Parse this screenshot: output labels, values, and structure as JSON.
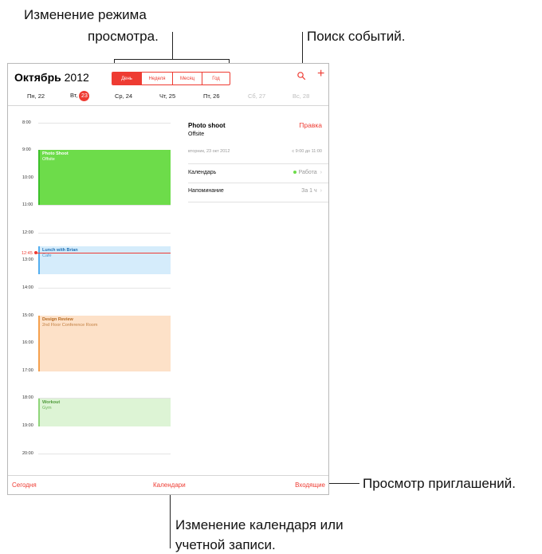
{
  "callouts": {
    "view_mode_line1": "Изменение режима",
    "view_mode_line2": "просмотра.",
    "search": "Поиск событий.",
    "invites": "Просмотр приглашений.",
    "calendar_line1": "Изменение календаря или",
    "calendar_line2": "учетной записи."
  },
  "header": {
    "month": "Октябрь",
    "year": "2012",
    "views": [
      "День",
      "Неделя",
      "Месяц",
      "Год"
    ],
    "active_view": "День",
    "search_icon": "search-icon",
    "add_icon": "plus-icon",
    "add_label": "+"
  },
  "week": {
    "days": [
      {
        "label": "Пн, 22"
      },
      {
        "label": "Вт,",
        "num": "23",
        "today": true
      },
      {
        "label": "Ср, 24"
      },
      {
        "label": "Чт, 25"
      },
      {
        "label": "Пт, 26"
      },
      {
        "label": "Сб, 27",
        "weekend": true
      },
      {
        "label": "Вс, 28",
        "weekend": true
      }
    ]
  },
  "timeline": {
    "hours": [
      "8:00",
      "9:00",
      "10:00",
      "11:00",
      "12:00",
      "13:00",
      "14:00",
      "15:00",
      "16:00",
      "17:00",
      "18:00",
      "19:00",
      "20:00"
    ],
    "now_label": "12:45"
  },
  "events": [
    {
      "id": "photo",
      "title": "Photo Shoot",
      "location": "Offsite"
    },
    {
      "id": "lunch",
      "title": "Lunch with Brian",
      "location": "Cafe"
    },
    {
      "id": "design",
      "title": "Design Review",
      "location": "2nd Floor Conference Room"
    },
    {
      "id": "workout",
      "title": "Workout",
      "location": "Gym"
    }
  ],
  "detail": {
    "title": "Photo shoot",
    "edit": "Правка",
    "location": "Offsite",
    "date": "вторник, 23 окт 2012",
    "time": "с 9:00 до 11:00",
    "calendar_label": "Календарь",
    "calendar_value": "Работа",
    "reminder_label": "Напоминание",
    "reminder_value": "За 1 ч",
    "chevron": "›"
  },
  "toolbar": {
    "today": "Сегодня",
    "calendars": "Календари",
    "inbox": "Входящие"
  },
  "colors": {
    "accent": "#ee3b32",
    "work_calendar": "#6ddc4a"
  }
}
